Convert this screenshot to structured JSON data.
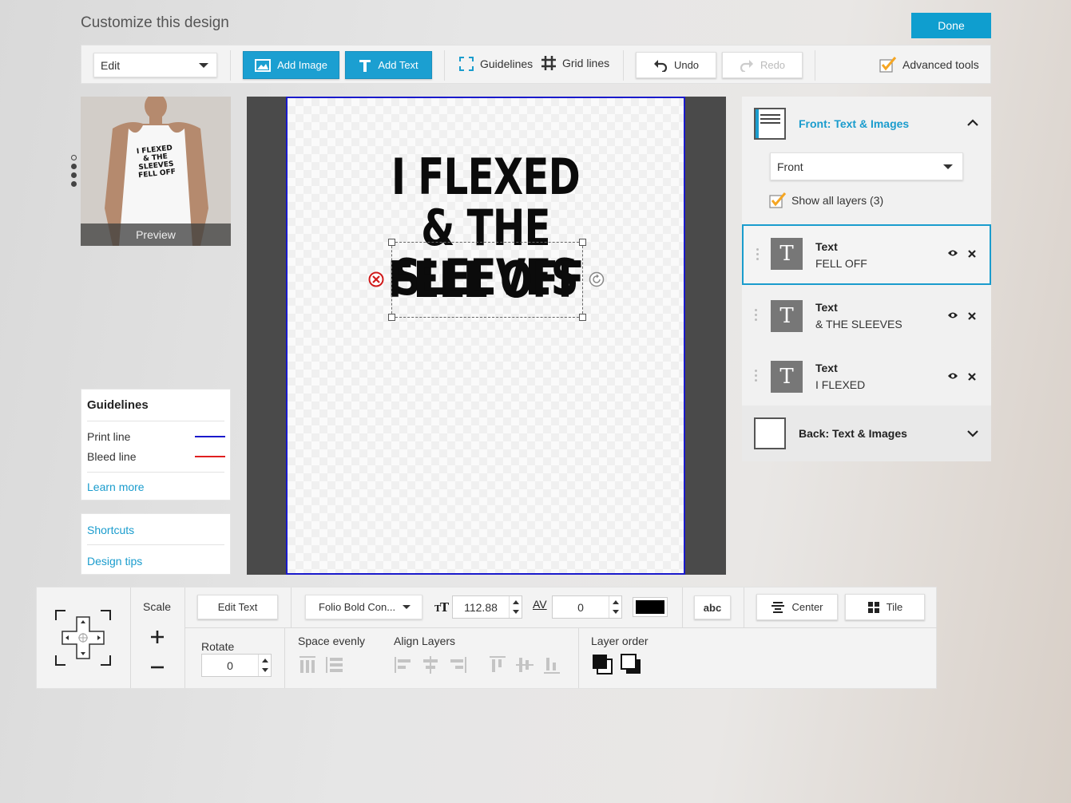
{
  "header": {
    "title": "Customize this design",
    "done_label": "Done"
  },
  "toolbar": {
    "mode_select": "Edit",
    "add_image_label": "Add Image",
    "add_text_label": "Add Text",
    "guidelines_label": "Guidelines",
    "gridlines_label": "Grid lines",
    "undo_label": "Undo",
    "redo_label": "Redo",
    "advanced_tools_label": "Advanced tools",
    "advanced_tools_checked": true
  },
  "preview": {
    "label": "Preview",
    "shirt_text": [
      "I FLEXED",
      "& THE SLEEVES",
      "FELL OFF"
    ]
  },
  "guidelines_card": {
    "title": "Guidelines",
    "print_line_label": "Print line",
    "print_line_color": "#1a1acc",
    "bleed_line_label": "Bleed line",
    "bleed_line_color": "#e02020",
    "learn_more": "Learn more"
  },
  "help_links": {
    "shortcuts": "Shortcuts",
    "design_tips": "Design tips"
  },
  "canvas": {
    "lines": [
      "I FLEXED",
      "& THE SLEEVES",
      "FELL OFF"
    ]
  },
  "right_panel": {
    "front_section_title": "Front: Text & Images",
    "side_select": "Front",
    "show_all_layers_label": "Show all layers (3)",
    "show_all_layers_checked": true,
    "layers": [
      {
        "type": "Text",
        "name": "FELL OFF",
        "active": true
      },
      {
        "type": "Text",
        "name": "& THE SLEEVES",
        "active": false
      },
      {
        "type": "Text",
        "name": "I FLEXED",
        "active": false
      }
    ],
    "back_section_title": "Back: Text & Images"
  },
  "bottom_panel": {
    "scale_label": "Scale",
    "rotate_label": "Rotate",
    "rotate_value": "0",
    "edit_text_label": "Edit Text",
    "font_select": "Folio Bold Con...",
    "font_size_value": "112.88",
    "letter_spacing_icon": "AV",
    "letter_spacing_value": "0",
    "text_color": "#000000",
    "abc_label": "abc",
    "center_label": "Center",
    "tile_label": "Tile",
    "space_evenly_label": "Space evenly",
    "align_layers_label": "Align Layers",
    "layer_order_label": "Layer order"
  },
  "colors": {
    "accent": "#1a9ccd",
    "done_button": "#0f9ecf",
    "check_orange": "#f5a623"
  }
}
